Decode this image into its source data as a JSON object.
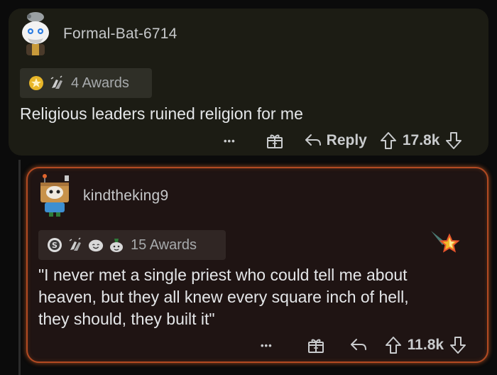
{
  "comments": [
    {
      "username": "Formal-Bat-6714",
      "awards_label": "4 Awards",
      "award_icons": [
        "gold-star-award-icon",
        "clapping-hands-award-icon"
      ],
      "body": "Religious leaders ruined religion for me",
      "actions": {
        "more": "•••",
        "reply": "Reply",
        "score": "17.8k"
      }
    },
    {
      "username": "kindtheking9",
      "awards_label": "15 Awards",
      "award_icons": [
        "silver-award-icon",
        "clapping-hands-award-icon",
        "wholesome-award-icon",
        "helpful-award-icon"
      ],
      "body_lines": [
        "\"I never met a single priest who could tell me about",
        "heaven, but they all knew every square inch of hell,",
        "they should, they built it\""
      ],
      "actions": {
        "more": "•••",
        "score": "11.8k"
      }
    }
  ],
  "colors": {
    "card_bg": "#1c1c14",
    "highlight_border": "#b24a22",
    "highlight_bg": "#1f1413",
    "text": "#e4e6e8",
    "muted": "#a7aaac"
  }
}
